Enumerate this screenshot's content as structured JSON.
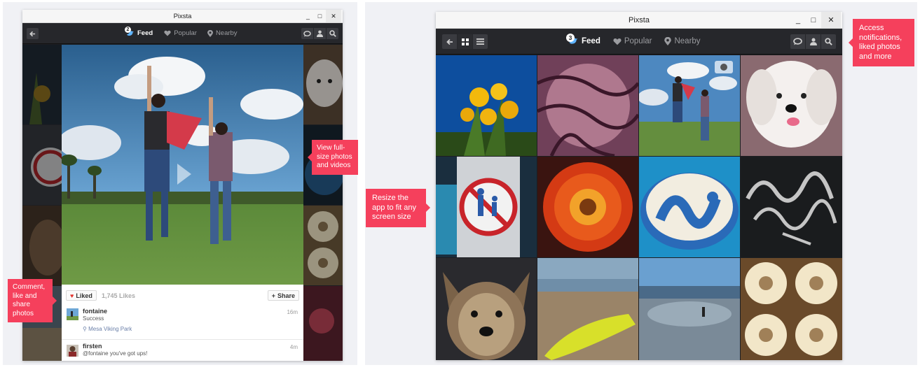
{
  "app": {
    "title": "Pixsta"
  },
  "window_controls": {
    "minimize": "_",
    "maximize": "□",
    "close": "✕"
  },
  "nav": {
    "tabs": [
      {
        "label": "Feed",
        "icon": "bird-icon",
        "active": true
      },
      {
        "label": "Popular",
        "icon": "heart-icon",
        "active": false
      },
      {
        "label": "Nearby",
        "icon": "pin-icon",
        "active": false
      }
    ],
    "left_view": {
      "feed_badge": "2"
    },
    "right_view": {
      "feed_badge": "3"
    }
  },
  "post": {
    "liked_label": "Liked",
    "likes_count": "1,745 Likes",
    "share_label": "Share",
    "comments": [
      {
        "user": "fontaine",
        "text": "Success",
        "location": "Mesa Viking Park",
        "time": "16m"
      },
      {
        "user": "firsten",
        "text": "@fontaine you've got ups!",
        "time": "4m"
      }
    ]
  },
  "callouts": {
    "view_full": "View full-size photos and videos",
    "comment_like": "Comment, like and share photos",
    "resize": "Resize the app to fit any screen size",
    "notifications": "Access notifications, liked photos and more"
  },
  "colors": {
    "accent": "#f5405c",
    "nav_bg": "#26272b",
    "window_bg": "#1d1e22"
  }
}
